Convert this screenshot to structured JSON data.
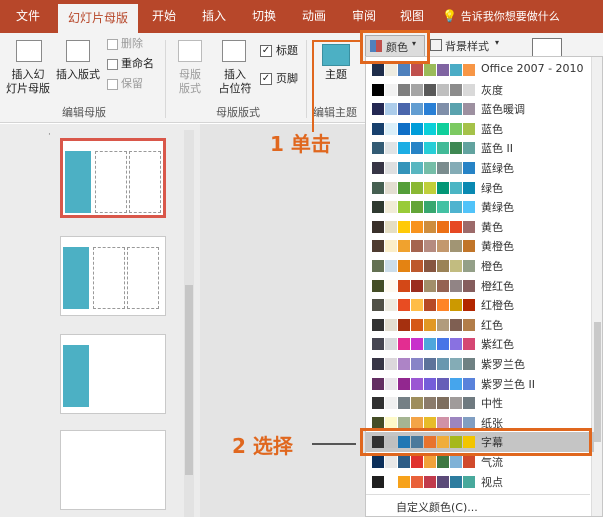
{
  "tabs": [
    "文件",
    "幻灯片母版",
    "开始",
    "插入",
    "切换",
    "动画",
    "审阅",
    "视图"
  ],
  "tell_me": "告诉我你想要做什么",
  "ribbon": {
    "insert_master": "插入幻\n灯片母版",
    "insert_layout": "插入版式",
    "delete": "删除",
    "rename": "重命名",
    "preserve": "保留",
    "group_edit_master": "编辑母版",
    "master_layout": "母版\n版式",
    "insert_placeholder": "插入\n占位符",
    "title_chk": "标题",
    "footer_chk": "页脚",
    "group_master_layout": "母版版式",
    "theme": "主题",
    "group_edit_theme": "编辑主题",
    "colors": "颜色",
    "bg_styles": "背景样式"
  },
  "annotations": {
    "step1": "1 单击",
    "step2": "2 选择"
  },
  "colors_menu": {
    "items": [
      {
        "label": "Office 2007 - 2010",
        "swatches": [
          "#1f2d4a",
          "#eeece1",
          "#4f81bd",
          "#c0504d",
          "#9bbb59",
          "#8064a2",
          "#4bacc6",
          "#f79646"
        ]
      },
      {
        "label": "灰度",
        "swatches": [
          "#000000",
          "#f2f2f2",
          "#7f7f7f",
          "#a5a5a5",
          "#595959",
          "#bfbfbf",
          "#8c8c8c",
          "#d9d9d9"
        ]
      },
      {
        "label": "蓝色暖调",
        "swatches": [
          "#242852",
          "#acccea",
          "#4a66ac",
          "#629dd1",
          "#297fd5",
          "#7f8fa9",
          "#5aa2ae",
          "#9d90a0"
        ]
      },
      {
        "label": "蓝色",
        "swatches": [
          "#17406d",
          "#dbeff9",
          "#0f6fc6",
          "#009dd9",
          "#0bd0d9",
          "#10cf9b",
          "#7cca62",
          "#a5c249"
        ]
      },
      {
        "label": "蓝色 II",
        "swatches": [
          "#335b74",
          "#dfe3e5",
          "#1cade4",
          "#2683c6",
          "#27ced7",
          "#42ba97",
          "#3e8853",
          "#62a39f"
        ]
      },
      {
        "label": "蓝绿色",
        "swatches": [
          "#373545",
          "#dedfe0",
          "#3494ba",
          "#58b6c0",
          "#75bda7",
          "#7a8c8e",
          "#84acb6",
          "#2683c6"
        ]
      },
      {
        "label": "绿色",
        "swatches": [
          "#455f51",
          "#e3ded1",
          "#549e39",
          "#8ab833",
          "#c0cf3a",
          "#029676",
          "#4ab5c4",
          "#0989b1"
        ]
      },
      {
        "label": "黄绿色",
        "swatches": [
          "#2f3a30",
          "#f1ecd7",
          "#99cb38",
          "#63a537",
          "#37a76f",
          "#44c1a3",
          "#4eb3cf",
          "#51c3f9"
        ]
      },
      {
        "label": "黄色",
        "swatches": [
          "#39302a",
          "#e5dec3",
          "#ffca08",
          "#f8931d",
          "#ce8d3e",
          "#ec7016",
          "#e64823",
          "#9c6a6a"
        ]
      },
      {
        "label": "黄橙色",
        "swatches": [
          "#4e3b30",
          "#fbeec9",
          "#f0a22e",
          "#a5644e",
          "#b58b80",
          "#c3986d",
          "#a19574",
          "#c17529"
        ]
      },
      {
        "label": "橙色",
        "swatches": [
          "#637052",
          "#ccddea",
          "#e48312",
          "#bd582c",
          "#865640",
          "#9b8357",
          "#c2bc80",
          "#94a088"
        ]
      },
      {
        "label": "橙红色",
        "swatches": [
          "#444d26",
          "#fef9ef",
          "#d34817",
          "#9b2d1f",
          "#a28e6a",
          "#956251",
          "#918485",
          "#855d5d"
        ]
      },
      {
        "label": "红橙色",
        "swatches": [
          "#505046",
          "#eeece1",
          "#e84c22",
          "#ffbd47",
          "#b64926",
          "#ff8427",
          "#cc9900",
          "#b22600"
        ]
      },
      {
        "label": "红色",
        "swatches": [
          "#323232",
          "#e3ded1",
          "#a5300f",
          "#d55816",
          "#e19825",
          "#b19c7d",
          "#7f5f52",
          "#b27d49"
        ]
      },
      {
        "label": "紫红色",
        "swatches": [
          "#454551",
          "#d8d9dc",
          "#e32d91",
          "#c830cc",
          "#4ea6dc",
          "#4775e7",
          "#8971e1",
          "#d54773"
        ]
      },
      {
        "label": "紫罗兰色",
        "swatches": [
          "#373545",
          "#dcd8dc",
          "#ad84c6",
          "#8784c7",
          "#5d739a",
          "#6997af",
          "#84acb6",
          "#6f8183"
        ]
      },
      {
        "label": "紫罗兰色 II",
        "swatches": [
          "#632e62",
          "#eae5eb",
          "#92278f",
          "#9b57d3",
          "#755dd9",
          "#665eb8",
          "#45a5ed",
          "#5982db"
        ]
      },
      {
        "label": "中性",
        "swatches": [
          "#303030",
          "#f0f0f0",
          "#758085",
          "#9e8e5c",
          "#8b7b6b",
          "#7e6e5e",
          "#a09b9a",
          "#6f7a80"
        ]
      },
      {
        "label": "纸张",
        "swatches": [
          "#444d26",
          "#fefac9",
          "#a5b592",
          "#f3a447",
          "#e7bc29",
          "#d092a7",
          "#9c85c0",
          "#809ec2"
        ]
      },
      {
        "label": "字幕",
        "swatches": [
          "#323232",
          "#bfbfbf",
          "#1f77b4",
          "#4c7a9c",
          "#e8732e",
          "#f0ad3a",
          "#a6b81b",
          "#f2c500"
        ]
      },
      {
        "label": "气流",
        "swatches": [
          "#0c2f5a",
          "#e8e8e8",
          "#2d5d87",
          "#e0322d",
          "#f1a23a",
          "#3e7741",
          "#7fb2d7",
          "#d14a2c"
        ]
      },
      {
        "label": "视点",
        "swatches": [
          "#1f1f1f",
          "#ffffff",
          "#f7a21b",
          "#e9613a",
          "#c13a4c",
          "#5b4a78",
          "#2d7c9f",
          "#48a99c"
        ]
      }
    ],
    "custom": "自定义颜色(C)..."
  }
}
